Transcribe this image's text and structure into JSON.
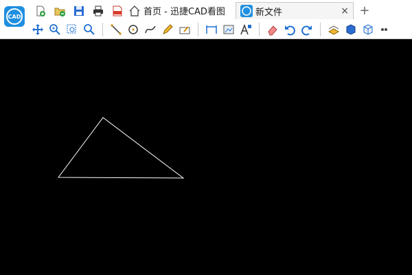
{
  "app": {
    "logo_text": "CAD",
    "logo_color": "#1f8fe0"
  },
  "quick_access": [
    "new-file-icon",
    "open-folder-icon",
    "save-icon",
    "print-icon",
    "export-pdf-icon"
  ],
  "tabs": [
    {
      "label": "首页 - 迅捷CAD看图",
      "icon": "home-icon",
      "active": false
    },
    {
      "label": "新文件",
      "icon": "cad-logo-icon",
      "active": true,
      "close": "×"
    }
  ],
  "new_tab": "+",
  "toolbar": {
    "groups": [
      [
        "pan-icon",
        "zoom-in-icon",
        "zoom-window-icon",
        "zoom-extents-icon"
      ],
      [
        "line-icon",
        "circle-icon",
        "spline-icon",
        "pencil-icon",
        "eraser-draw-icon"
      ],
      [
        "dimension-icon",
        "measure-area-icon",
        "text-icon"
      ],
      [
        "erase-icon",
        "undo-icon",
        "redo-icon"
      ],
      [
        "layer-icon",
        "3d-box-icon",
        "3d-view-icon",
        "more-icon"
      ]
    ]
  },
  "drawing": {
    "background": "#000000",
    "stroke": "#ffffff",
    "shape": "triangle"
  }
}
